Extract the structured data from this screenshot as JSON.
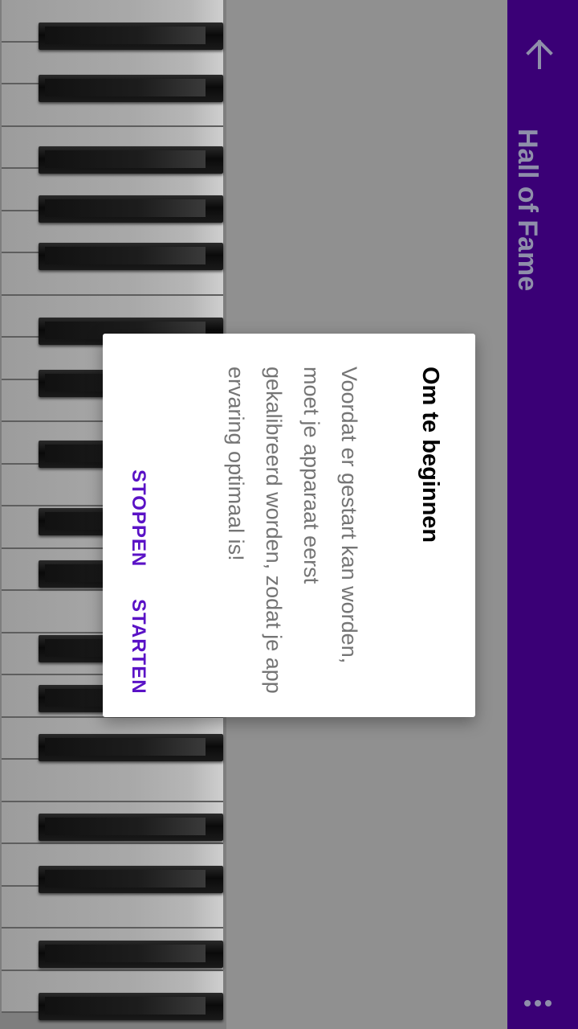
{
  "toolbar": {
    "title": "Hall of Fame",
    "back_icon": "arrow-back-icon",
    "more_icon": "more-vert-icon",
    "color": "#3a0076"
  },
  "dialog": {
    "title": "Om te beginnen",
    "message": "Voordat er gestart kan worden, moet je apparaat eerst gekalibreerd worden, zodat je app ervaring optimaal is!",
    "buttons": {
      "stop_label": "STOPPEN",
      "start_label": "STARTEN"
    },
    "button_color": "#5a12c6"
  },
  "piano": {
    "white_key_count": 24
  }
}
